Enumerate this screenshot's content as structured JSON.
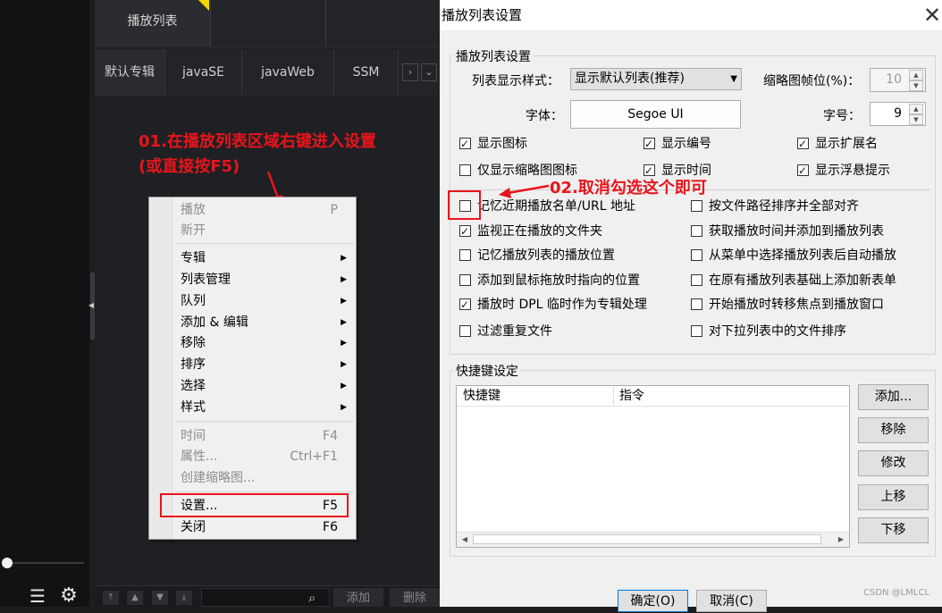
{
  "player": {
    "playlist_tab": "播放列表",
    "albums": [
      "默认专辑",
      "javaSE",
      "javaWeb",
      "SSM"
    ],
    "nav_right": "›",
    "nav_down": "⌄",
    "bottom_buttons": [
      "⤒",
      "▲",
      "▼",
      "⤓"
    ],
    "add_label": "添加",
    "delete_label": "删除",
    "list_icon": "☰",
    "gear_icon": "⚙",
    "search_icon": "⌕"
  },
  "annotations": {
    "note1_line1": "01.在播放列表区域右键进入设置",
    "note1_line2": "(或直接按F5)",
    "note2": "02.取消勾选这个即可",
    "color": "#e8141c"
  },
  "context_menu": {
    "items": [
      {
        "label": "播放",
        "shortcut": "P",
        "disabled": true
      },
      {
        "label": "新开",
        "shortcut": "",
        "disabled": true
      },
      {
        "label": "专辑",
        "submenu": true
      },
      {
        "label": "列表管理",
        "submenu": true
      },
      {
        "label": "队列",
        "submenu": true
      },
      {
        "label": "添加 & 编辑",
        "submenu": true
      },
      {
        "label": "移除",
        "submenu": true
      },
      {
        "label": "排序",
        "submenu": true
      },
      {
        "label": "选择",
        "submenu": true
      },
      {
        "label": "样式",
        "submenu": true
      },
      {
        "label": "时间",
        "shortcut": "F4",
        "disabled": true
      },
      {
        "label": "属性...",
        "shortcut": "Ctrl+F1",
        "disabled": true
      },
      {
        "label": "创建缩略图...",
        "shortcut": "",
        "disabled": true
      },
      {
        "label": "设置...",
        "shortcut": "F5"
      },
      {
        "label": "关闭",
        "shortcut": "F6"
      }
    ],
    "submenu_arrow": "▶"
  },
  "dialog": {
    "title": "播放列表设置",
    "close": "✕",
    "group1_title": "播放列表设置",
    "style_label": "列表显示样式：",
    "style_value": "显示默认列表(推荐)",
    "style_arrow": "▼",
    "thumb_label": "缩略图帧位(%)：",
    "thumb_value": "10",
    "font_label": "字体：",
    "font_value": "Segoe UI",
    "size_label": "字号：",
    "size_value": "9",
    "spin_up": "▲",
    "spin_down": "▼",
    "checkboxes": [
      {
        "label": "显示图标",
        "checked": true
      },
      {
        "label": "显示编号",
        "checked": true
      },
      {
        "label": "显示扩展名",
        "checked": true
      },
      {
        "label": "仅显示缩略图图标",
        "checked": false
      },
      {
        "label": "显示时间",
        "checked": true
      },
      {
        "label": "显示浮悬提示",
        "checked": true
      },
      {
        "label": "记忆近期播放名单/URL 地址",
        "checked": false
      },
      {
        "label": "按文件路径排序并全部对齐",
        "checked": false
      },
      {
        "label": "监视正在播放的文件夹",
        "checked": true
      },
      {
        "label": "获取播放时间并添加到播放列表",
        "checked": false
      },
      {
        "label": "记忆播放列表的播放位置",
        "checked": false
      },
      {
        "label": "从菜单中选择播放列表后自动播放",
        "checked": false
      },
      {
        "label": "添加到鼠标拖放时指向的位置",
        "checked": false
      },
      {
        "label": "在原有播放列表基础上添加新表单",
        "checked": false
      },
      {
        "label": "播放时 DPL 临时作为专辑处理",
        "checked": true
      },
      {
        "label": "开始播放时转移焦点到播放窗口",
        "checked": false
      },
      {
        "label": "过滤重复文件",
        "checked": false
      },
      {
        "label": "对下拉列表中的文件排序",
        "checked": false
      }
    ],
    "group2_title": "快捷键设定",
    "table_headers": [
      "快捷键",
      "指令"
    ],
    "scroll_left": "◀",
    "scroll_right": "▶",
    "side_buttons": [
      "添加...",
      "移除",
      "修改",
      "上移",
      "下移"
    ],
    "ok": "确定(O)",
    "cancel": "取消(C)"
  },
  "watermark": "CSDN @LMLCL"
}
